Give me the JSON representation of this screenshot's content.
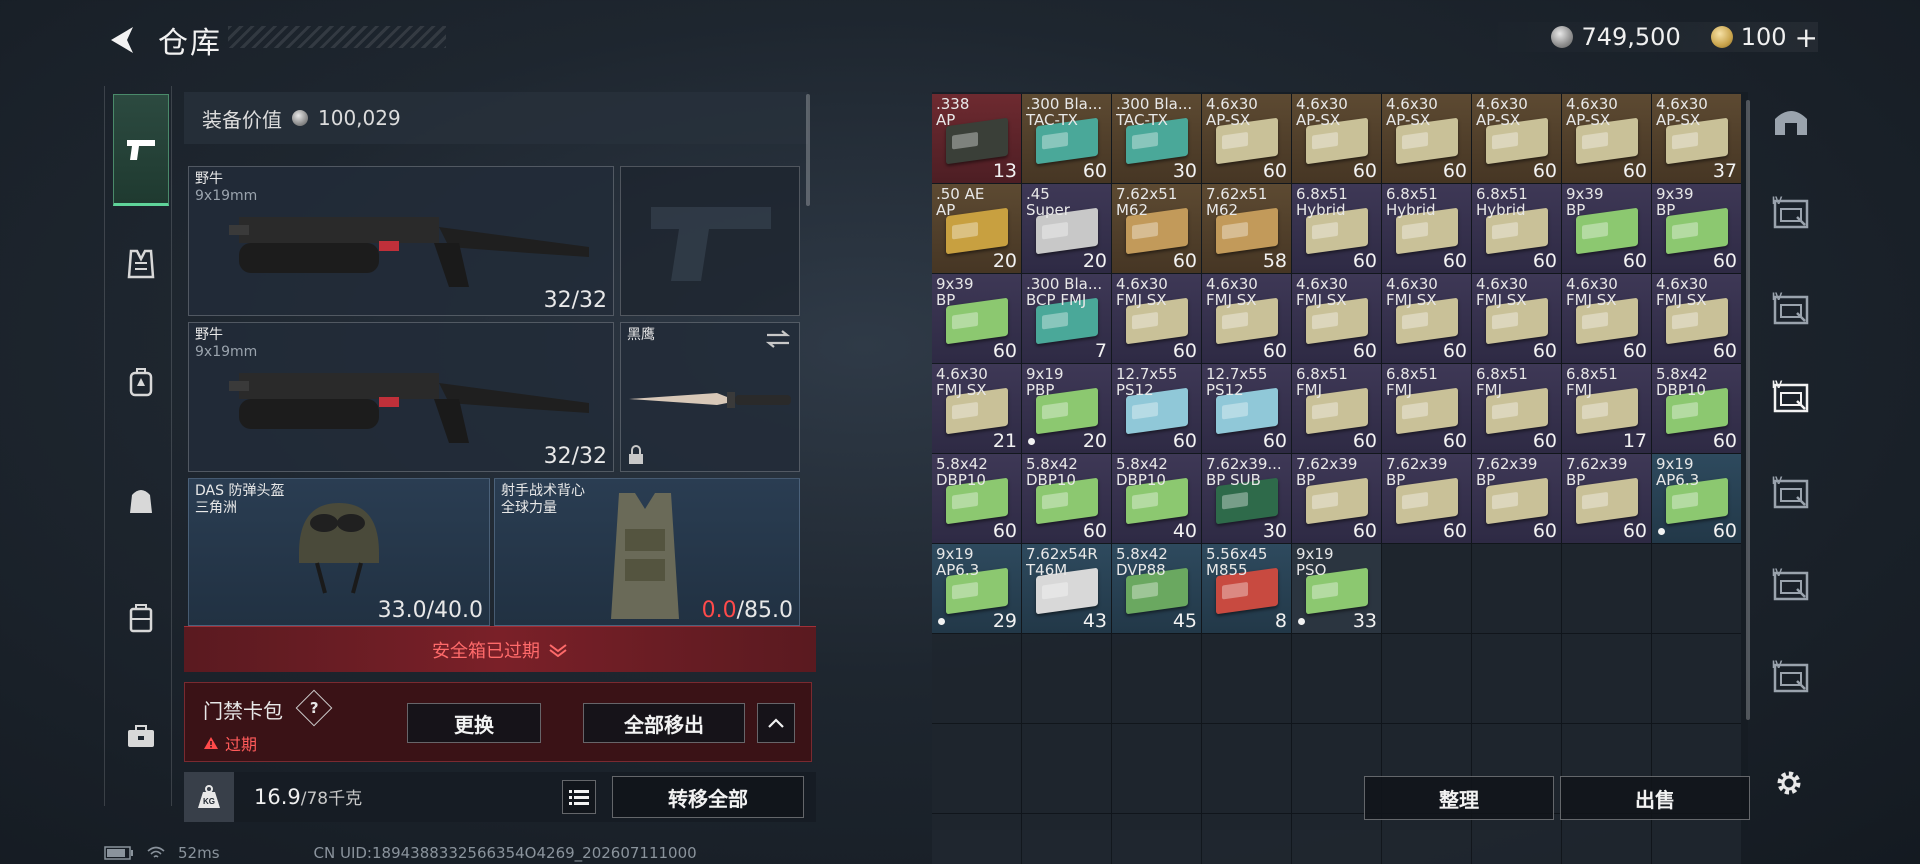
{
  "header": {
    "title": "仓库",
    "silver_amount": "749,500",
    "gold_amount": "100",
    "gold_add": "+"
  },
  "left_nav": {
    "items": [
      {
        "icon": "pistol-icon",
        "active": true
      },
      {
        "icon": "armor-vest-icon"
      },
      {
        "icon": "backpack-icon"
      },
      {
        "icon": "bag-icon"
      },
      {
        "icon": "container-icon"
      },
      {
        "icon": "toolbox-icon"
      }
    ]
  },
  "loadout": {
    "equip_value_label": "装备价值",
    "equip_value": "100,029",
    "primary1": {
      "name": "野牛",
      "caliber": "9x19mm",
      "ammo": "32/32"
    },
    "primary2": {
      "name": "野牛",
      "caliber": "9x19mm",
      "ammo": "32/32"
    },
    "melee": {
      "name": "黑鹰"
    },
    "helmet": {
      "name": "DAS 防弹头盔",
      "sub": "三角洲",
      "durability_current": "33.0",
      "durability_max": "/40.0"
    },
    "vest": {
      "name": "射手战术背心",
      "sub": "全球力量",
      "durability_current": "0.0",
      "durability_max": "/85.0"
    }
  },
  "safebox": {
    "expired_label": "安全箱已过期",
    "keycard_label": "门禁卡包",
    "help": "?",
    "status": "过期",
    "replace_button": "更换",
    "remove_all_button": "全部移出"
  },
  "weight": {
    "current": "16.9",
    "max": "/78千克",
    "kg_icon_text": "KG",
    "transfer_all_button": "转移全部"
  },
  "status_bar": {
    "ping": "52ms",
    "uid": "CN UID:1894388332566354O4269_202607111000"
  },
  "stash": {
    "items": [
      {
        "name": ".338",
        "sub": "AP",
        "qty": "13",
        "rarity": "rare-red",
        "box": "#3a3f38"
      },
      {
        "name": ".300 Bla...",
        "sub": "TAC-TX",
        "qty": "60",
        "rarity": "rare-gold",
        "box": "#4aa899"
      },
      {
        "name": ".300 Bla...",
        "sub": "TAC-TX",
        "qty": "30",
        "rarity": "rare-gold",
        "box": "#4aa899"
      },
      {
        "name": "4.6x30",
        "sub": "AP-SX",
        "qty": "60",
        "rarity": "rare-gold",
        "box": "#c9c198"
      },
      {
        "name": "4.6x30",
        "sub": "AP-SX",
        "qty": "60",
        "rarity": "rare-gold",
        "box": "#c9c198"
      },
      {
        "name": "4.6x30",
        "sub": "AP-SX",
        "qty": "60",
        "rarity": "rare-gold",
        "box": "#c9c198"
      },
      {
        "name": "4.6x30",
        "sub": "AP-SX",
        "qty": "60",
        "rarity": "rare-gold",
        "box": "#c9c198"
      },
      {
        "name": "4.6x30",
        "sub": "AP-SX",
        "qty": "60",
        "rarity": "rare-gold",
        "box": "#c9c198"
      },
      {
        "name": "4.6x30",
        "sub": "AP-SX",
        "qty": "37",
        "rarity": "rare-gold",
        "box": "#c9c198"
      },
      {
        "name": ".50 AE",
        "sub": "AP",
        "qty": "20",
        "rarity": "rare-gold",
        "box": "#c8a040"
      },
      {
        "name": ".45",
        "sub": "Super",
        "qty": "20",
        "rarity": "rare-purple",
        "box": "#c8c8c8"
      },
      {
        "name": "7.62x51",
        "sub": "M62",
        "qty": "60",
        "rarity": "rare-gold",
        "box": "#c29a5a"
      },
      {
        "name": "7.62x51",
        "sub": "M62",
        "qty": "58",
        "rarity": "rare-gold",
        "box": "#c29a5a"
      },
      {
        "name": "6.8x51",
        "sub": "Hybrid",
        "qty": "60",
        "rarity": "rare-purple",
        "box": "#c9c198"
      },
      {
        "name": "6.8x51",
        "sub": "Hybrid",
        "qty": "60",
        "rarity": "rare-purple",
        "box": "#c9c198"
      },
      {
        "name": "6.8x51",
        "sub": "Hybrid",
        "qty": "60",
        "rarity": "rare-purple",
        "box": "#c9c198"
      },
      {
        "name": "9x39",
        "sub": "BP",
        "qty": "60",
        "rarity": "rare-purple",
        "box": "#8cc870"
      },
      {
        "name": "9x39",
        "sub": "BP",
        "qty": "60",
        "rarity": "rare-purple",
        "box": "#8cc870"
      },
      {
        "name": "9x39",
        "sub": "BP",
        "qty": "60",
        "rarity": "rare-purple",
        "box": "#8cc870"
      },
      {
        "name": ".300 Bla...",
        "sub": "BCP FMJ",
        "qty": "7",
        "rarity": "rare-purple",
        "box": "#4aa899"
      },
      {
        "name": "4.6x30",
        "sub": "FMJ SX",
        "qty": "60",
        "rarity": "rare-purple",
        "box": "#c9c198"
      },
      {
        "name": "4.6x30",
        "sub": "FMJ SX",
        "qty": "60",
        "rarity": "rare-purple",
        "box": "#c9c198"
      },
      {
        "name": "4.6x30",
        "sub": "FMJ SX",
        "qty": "60",
        "rarity": "rare-purple",
        "box": "#c9c198"
      },
      {
        "name": "4.6x30",
        "sub": "FMJ SX",
        "qty": "60",
        "rarity": "rare-purple",
        "box": "#c9c198"
      },
      {
        "name": "4.6x30",
        "sub": "FMJ SX",
        "qty": "60",
        "rarity": "rare-purple",
        "box": "#c9c198"
      },
      {
        "name": "4.6x30",
        "sub": "FMJ SX",
        "qty": "60",
        "rarity": "rare-purple",
        "box": "#c9c198"
      },
      {
        "name": "4.6x30",
        "sub": "FMJ SX",
        "qty": "60",
        "rarity": "rare-purple",
        "box": "#c9c198"
      },
      {
        "name": "4.6x30",
        "sub": "FMJ SX",
        "qty": "21",
        "rarity": "rare-purple",
        "box": "#c9c198"
      },
      {
        "name": "9x19",
        "sub": "PBP",
        "qty": "20",
        "rarity": "rare-purple",
        "box": "#8cc870",
        "dot": true
      },
      {
        "name": "12.7x55",
        "sub": "PS12",
        "qty": "60",
        "rarity": "rare-purple",
        "box": "#90c8d8"
      },
      {
        "name": "12.7x55",
        "sub": "PS12",
        "qty": "60",
        "rarity": "rare-purple",
        "box": "#90c8d8"
      },
      {
        "name": "6.8x51",
        "sub": "FMJ",
        "qty": "60",
        "rarity": "rare-purple",
        "box": "#c9c198"
      },
      {
        "name": "6.8x51",
        "sub": "FMJ",
        "qty": "60",
        "rarity": "rare-purple",
        "box": "#c9c198"
      },
      {
        "name": "6.8x51",
        "sub": "FMJ",
        "qty": "60",
        "rarity": "rare-purple",
        "box": "#c9c198"
      },
      {
        "name": "6.8x51",
        "sub": "FMJ",
        "qty": "17",
        "rarity": "rare-purple",
        "box": "#c9c198"
      },
      {
        "name": "5.8x42",
        "sub": "DBP10",
        "qty": "60",
        "rarity": "rare-purple",
        "box": "#8cc870"
      },
      {
        "name": "5.8x42",
        "sub": "DBP10",
        "qty": "60",
        "rarity": "rare-purple",
        "box": "#8cc870"
      },
      {
        "name": "5.8x42",
        "sub": "DBP10",
        "qty": "60",
        "rarity": "rare-purple",
        "box": "#8cc870"
      },
      {
        "name": "5.8x42",
        "sub": "DBP10",
        "qty": "40",
        "rarity": "rare-purple",
        "box": "#8cc870"
      },
      {
        "name": "7.62x39...",
        "sub": "BP SUB",
        "qty": "30",
        "rarity": "rare-purple",
        "box": "#2e6a4a"
      },
      {
        "name": "7.62x39",
        "sub": "BP",
        "qty": "60",
        "rarity": "rare-purple",
        "box": "#c9c198"
      },
      {
        "name": "7.62x39",
        "sub": "BP",
        "qty": "60",
        "rarity": "rare-purple",
        "box": "#c9c198"
      },
      {
        "name": "7.62x39",
        "sub": "BP",
        "qty": "60",
        "rarity": "rare-purple",
        "box": "#c9c198"
      },
      {
        "name": "7.62x39",
        "sub": "BP",
        "qty": "60",
        "rarity": "rare-purple",
        "box": "#c9c198"
      },
      {
        "name": "9x19",
        "sub": "AP6.3",
        "qty": "60",
        "rarity": "rare-blue",
        "box": "#8cc870",
        "dot": true
      },
      {
        "name": "9x19",
        "sub": "AP6.3",
        "qty": "29",
        "rarity": "rare-blue",
        "box": "#8cc870",
        "dot": true
      },
      {
        "name": "7.62x54R",
        "sub": "T46M",
        "qty": "43",
        "rarity": "rare-blue",
        "box": "#d8d8d8"
      },
      {
        "name": "5.8x42",
        "sub": "DVP88",
        "qty": "45",
        "rarity": "rare-blue",
        "box": "#6aa860"
      },
      {
        "name": "5.56x45",
        "sub": "M855",
        "qty": "8",
        "rarity": "rare-blue",
        "box": "#c84a40"
      },
      {
        "name": "9x19",
        "sub": "PSO",
        "qty": "33",
        "rarity": "",
        "box": "#8cc870",
        "dot": true
      }
    ],
    "empty_cells": 31,
    "sort_button": "整理",
    "sell_button": "出售"
  },
  "right_tabs": [
    {
      "icon": "helmet-tab-icon",
      "label": ""
    },
    {
      "icon": "stash-iv-icon",
      "label": "IV"
    },
    {
      "icon": "stash-iv-2-icon",
      "label": "IV"
    },
    {
      "icon": "stash-iv-active-icon",
      "label": "IV"
    },
    {
      "icon": "stash-iv-3-icon",
      "label": "IV"
    },
    {
      "icon": "stash-iv-4-icon",
      "label": "IV"
    },
    {
      "icon": "stash-iv-5-icon",
      "label": "IV"
    }
  ]
}
